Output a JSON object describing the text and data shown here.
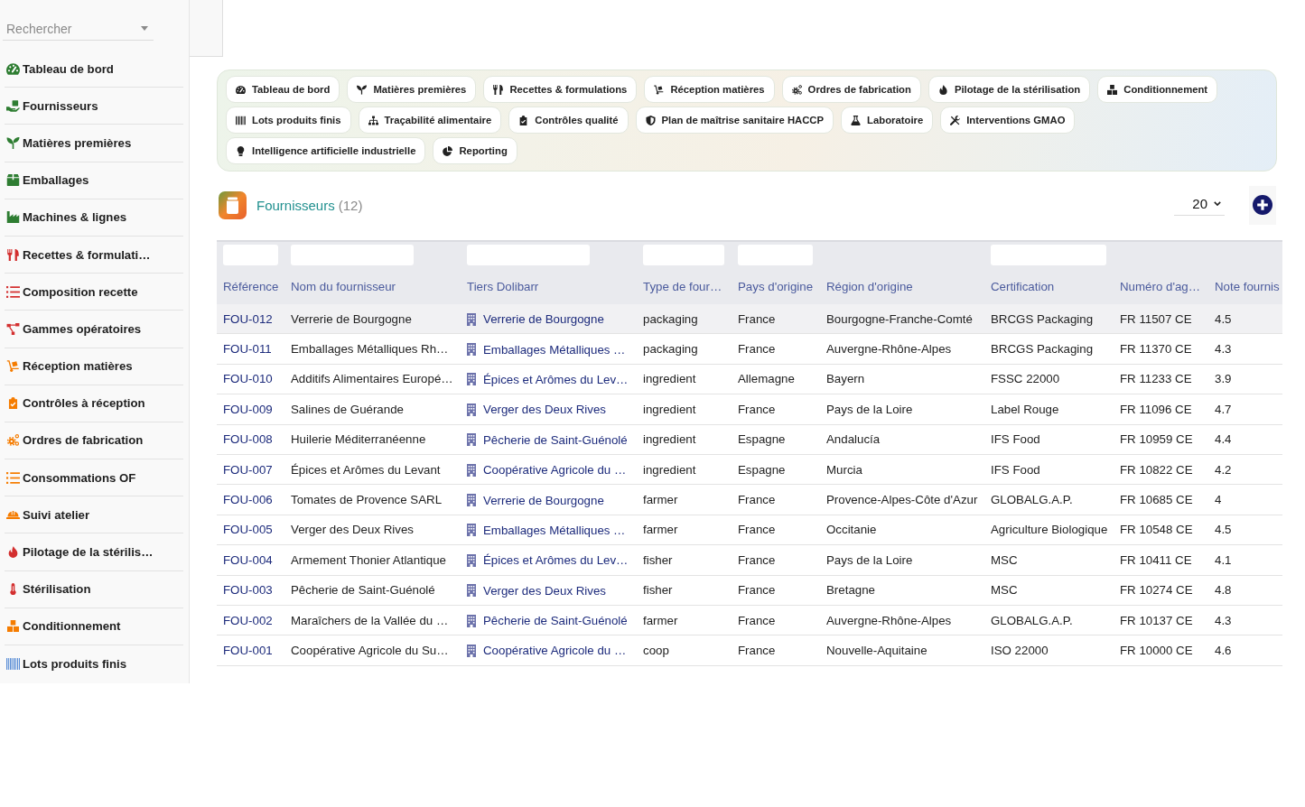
{
  "sidebar": {
    "search": {
      "placeholder": "Rechercher"
    },
    "items": [
      {
        "label": "Tableau de bord",
        "color": "#2e7d32"
      },
      {
        "label": "Fournisseurs",
        "color": "#2e7d32"
      },
      {
        "label": "Matières premières",
        "color": "#2e7d32"
      },
      {
        "label": "Emballages",
        "color": "#2e7d32"
      },
      {
        "label": "Machines & lignes",
        "color": "#2e7d32"
      },
      {
        "label": "Recettes & formulati…",
        "color": "#d32f2f"
      },
      {
        "label": "Composition recette",
        "color": "#d32f2f"
      },
      {
        "label": "Gammes opératoires",
        "color": "#d32f2f"
      },
      {
        "label": "Réception matières",
        "color": "#f57c00"
      },
      {
        "label": "Contrôles à réception",
        "color": "#f57c00"
      },
      {
        "label": "Ordres de fabrication",
        "color": "#f57c00"
      },
      {
        "label": "Consommations OF",
        "color": "#f57c00"
      },
      {
        "label": "Suivi atelier",
        "color": "#f57c00"
      },
      {
        "label": "Pilotage de la stérilis…",
        "color": "#d32f2f"
      },
      {
        "label": "Stérilisation",
        "color": "#d32f2f"
      },
      {
        "label": "Conditionnement",
        "color": "#f57c00"
      },
      {
        "label": "Lots produits finis",
        "color": "#5b8ed6"
      }
    ]
  },
  "quick_links": [
    {
      "label": "Tableau de bord"
    },
    {
      "label": "Matières premières"
    },
    {
      "label": "Recettes & formulations"
    },
    {
      "label": "Réception matières"
    },
    {
      "label": "Ordres de fabrication"
    },
    {
      "label": "Pilotage de la stérilisation"
    },
    {
      "label": "Conditionnement"
    },
    {
      "label": "Lots produits finis"
    },
    {
      "label": "Traçabilité alimentaire"
    },
    {
      "label": "Contrôles qualité"
    },
    {
      "label": "Plan de maîtrise sanitaire HACCP"
    },
    {
      "label": "Laboratoire"
    },
    {
      "label": "Interventions GMAO"
    },
    {
      "label": "Intelligence artificielle industrielle"
    },
    {
      "label": "Reporting"
    }
  ],
  "list_header": {
    "title": "Fournisseurs",
    "count": "(12)",
    "page_size": "20"
  },
  "table": {
    "columns": [
      {
        "label": "Référence",
        "kind": "link",
        "filter": true
      },
      {
        "label": "Nom du fournisseur",
        "kind": "text",
        "filter": true
      },
      {
        "label": "Tiers Dolibarr",
        "kind": "party",
        "filter": true
      },
      {
        "label": "Type de four…",
        "kind": "text",
        "filter": true
      },
      {
        "label": "Pays d'origine",
        "kind": "text",
        "filter": true
      },
      {
        "label": "Région d'origine",
        "kind": "text",
        "filter": false
      },
      {
        "label": "Certification",
        "kind": "text",
        "filter": true
      },
      {
        "label": "Numéro d'ag…",
        "kind": "text",
        "filter": false
      },
      {
        "label": "Note fournis",
        "kind": "text",
        "filter": false
      }
    ],
    "rows": [
      {
        "highlighted": true,
        "cells": [
          "FOU-012",
          "Verrerie de Bourgogne",
          "Verrerie de Bourgogne",
          "packaging",
          "France",
          "Bourgogne-Franche-Comté",
          "BRCGS Packaging",
          "FR 11507 CE",
          "4.5"
        ]
      },
      {
        "highlighted": false,
        "cells": [
          "FOU-011",
          "Emballages Métalliques Rh…",
          "Emballages Métalliques …",
          "packaging",
          "France",
          "Auvergne-Rhône-Alpes",
          "BRCGS Packaging",
          "FR 11370 CE",
          "4.3"
        ]
      },
      {
        "highlighted": false,
        "cells": [
          "FOU-010",
          "Additifs Alimentaires Europé…",
          "Épices et Arômes du Lev…",
          "ingredient",
          "Allemagne",
          "Bayern",
          "FSSC 22000",
          "FR 11233 CE",
          "3.9"
        ]
      },
      {
        "highlighted": false,
        "cells": [
          "FOU-009",
          "Salines de Guérande",
          "Verger des Deux Rives",
          "ingredient",
          "France",
          "Pays de la Loire",
          "Label Rouge",
          "FR 11096 CE",
          "4.7"
        ]
      },
      {
        "highlighted": false,
        "cells": [
          "FOU-008",
          "Huilerie Méditerranéenne",
          "Pêcherie de Saint-Guénolé",
          "ingredient",
          "Espagne",
          "Andalucía",
          "IFS Food",
          "FR 10959 CE",
          "4.4"
        ]
      },
      {
        "highlighted": false,
        "cells": [
          "FOU-007",
          "Épices et Arômes du Levant",
          "Coopérative Agricole du …",
          "ingredient",
          "Espagne",
          "Murcia",
          "IFS Food",
          "FR 10822 CE",
          "4.2"
        ]
      },
      {
        "highlighted": false,
        "cells": [
          "FOU-006",
          "Tomates de Provence SARL",
          "Verrerie de Bourgogne",
          "farmer",
          "France",
          "Provence-Alpes-Côte d'Azur",
          "GLOBALG.A.P.",
          "FR 10685 CE",
          "4"
        ]
      },
      {
        "highlighted": false,
        "cells": [
          "FOU-005",
          "Verger des Deux Rives",
          "Emballages Métalliques …",
          "farmer",
          "France",
          "Occitanie",
          "Agriculture Biologique",
          "FR 10548 CE",
          "4.5"
        ]
      },
      {
        "highlighted": false,
        "cells": [
          "FOU-004",
          "Armement Thonier Atlantique",
          "Épices et Arômes du Lev…",
          "fisher",
          "France",
          "Pays de la Loire",
          "MSC",
          "FR 10411 CE",
          "4.1"
        ]
      },
      {
        "highlighted": false,
        "cells": [
          "FOU-003",
          "Pêcherie de Saint-Guénolé",
          "Verger des Deux Rives",
          "fisher",
          "France",
          "Bretagne",
          "MSC",
          "FR 10274 CE",
          "4.8"
        ]
      },
      {
        "highlighted": false,
        "cells": [
          "FOU-002",
          "Maraîchers de la Vallée du …",
          "Pêcherie de Saint-Guénolé",
          "farmer",
          "France",
          "Auvergne-Rhône-Alpes",
          "GLOBALG.A.P.",
          "FR 10137 CE",
          "4.3"
        ]
      },
      {
        "highlighted": false,
        "cells": [
          "FOU-001",
          "Coopérative Agricole du Su…",
          "Coopérative Agricole du …",
          "coop",
          "France",
          "Nouvelle-Aquitaine",
          "ISO 22000",
          "FR 10000 CE",
          "4.6"
        ]
      }
    ]
  }
}
